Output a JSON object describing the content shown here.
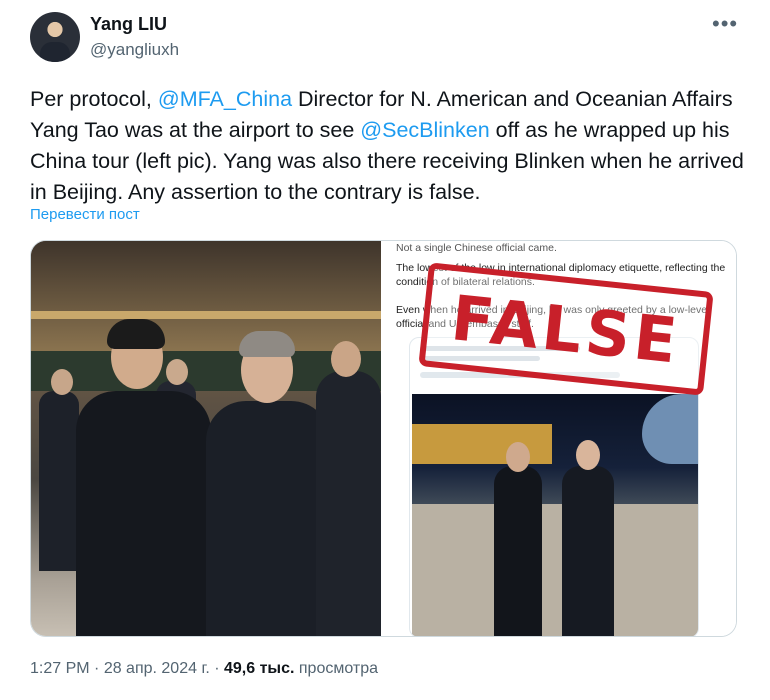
{
  "author": {
    "name": "Yang LIU",
    "handle": "@yangliuxh"
  },
  "tweet": {
    "t1": "Per protocol, ",
    "m1": "@MFA_China",
    "t2": " Director for N. American and Oceanian Affairs Yang Tao was at the airport to see ",
    "m2": "@SecBlinken",
    "t3": " off as he wrapped up his China tour (left pic). Yang was also there receiving Blinken when he arrived in Beijing. Any assertion to the contrary is false."
  },
  "translate_label": "Перевести пост",
  "media": {
    "right_pic": {
      "line0": "Not a single Chinese official came.",
      "line1": "The lowest of the low in international diplomacy etiquette, reflecting the condition of bilateral relations.",
      "line2": "Even when he arrived in Beijing, he was only greeted by a low-level official and US embassy staff.",
      "stamp": "FALSE"
    }
  },
  "footer": {
    "time": "1:27 PM",
    "sep1": " · ",
    "date": "28 апр. 2024 г.",
    "sep2": " · ",
    "views_count": "49,6 тыс.",
    "views_label": " просмотра"
  },
  "icons": {
    "more": "more-dots-icon"
  },
  "colors": {
    "mention": "#1d9bf0",
    "stamp": "#c8202a",
    "secondary_text": "#536471"
  }
}
